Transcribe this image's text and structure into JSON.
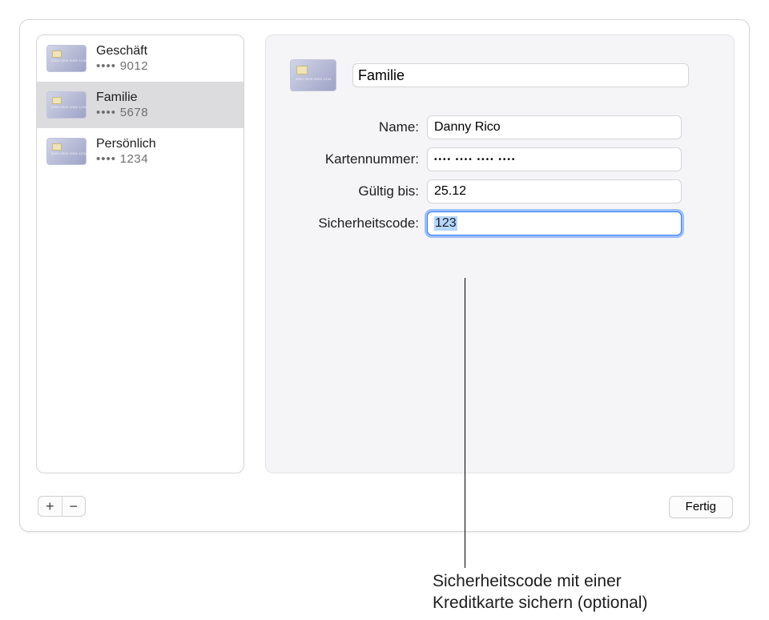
{
  "sidebar": {
    "items": [
      {
        "label": "Geschäft",
        "last4": "9012",
        "selected": false
      },
      {
        "label": "Familie",
        "last4": "5678",
        "selected": true
      },
      {
        "label": "Persönlich",
        "last4": "1234",
        "selected": false
      }
    ],
    "dots": "••••"
  },
  "detail": {
    "title_value": "Familie",
    "fields": {
      "name": {
        "label": "Name:",
        "value": "Danny Rico"
      },
      "card_number": {
        "label": "Kartennummer:",
        "masked_value": "•••• •••• •••• ••••"
      },
      "expiry": {
        "label": "Gültig bis:",
        "value": "25.12"
      },
      "security_code": {
        "label": "Sicherheitscode:",
        "value": "123"
      }
    }
  },
  "buttons": {
    "add": "+",
    "remove": "−",
    "done": "Fertig"
  },
  "annotation": {
    "line1": "Sicherheitscode mit einer",
    "line2": "Kreditkarte sichern (optional)"
  }
}
